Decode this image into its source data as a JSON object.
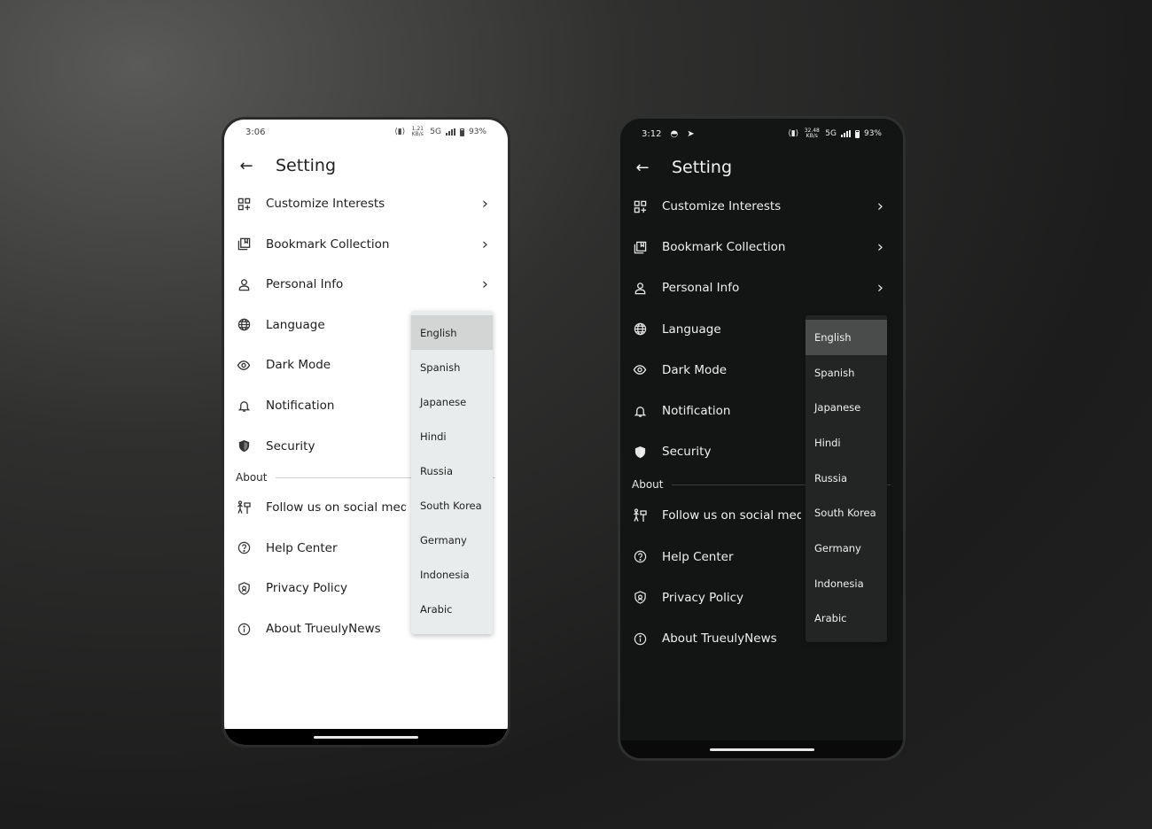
{
  "screens": [
    {
      "theme": "light",
      "status": {
        "time": "3:06",
        "speed": "1.21 KB/s",
        "net": "5G",
        "battery": "93%"
      },
      "title": "Setting",
      "items": [
        {
          "label": "Customize Interests",
          "icon": "grid-plus-icon",
          "chevron": true
        },
        {
          "label": "Bookmark Collection",
          "icon": "bookmark-stack-icon",
          "chevron": true
        },
        {
          "label": "Personal Info",
          "icon": "user-icon",
          "chevron": true
        },
        {
          "label": "Language",
          "icon": "globe-icon",
          "chevron": false
        },
        {
          "label": "Dark Mode",
          "icon": "eye-icon",
          "chevron": false
        },
        {
          "label": "Notification",
          "icon": "bell-icon",
          "chevron": false
        },
        {
          "label": "Security",
          "icon": "shield-icon",
          "chevron": false
        }
      ],
      "section": "About",
      "about_items": [
        {
          "label": "Follow us on social media",
          "icon": "social-icon",
          "chevron": false
        },
        {
          "label": "Help Center",
          "icon": "help-icon",
          "chevron": false
        },
        {
          "label": "Privacy Policy",
          "icon": "privacy-shield-icon",
          "chevron": false
        },
        {
          "label": "About TrueulyNews",
          "icon": "info-icon",
          "chevron": true
        }
      ],
      "languages": [
        "English",
        "Spanish",
        "Japanese",
        "Hindi",
        "Russia",
        "South Korea",
        "Germany",
        "Indonesia",
        "Arabic"
      ],
      "selected_language": "English"
    },
    {
      "theme": "dark",
      "status": {
        "time": "3:12",
        "speed": "32.48 KB/s",
        "net": "5G",
        "battery": "93%"
      },
      "title": "Setting",
      "items": [
        {
          "label": "Customize Interests",
          "icon": "grid-plus-icon",
          "chevron": true
        },
        {
          "label": "Bookmark Collection",
          "icon": "bookmark-stack-icon",
          "chevron": true
        },
        {
          "label": "Personal Info",
          "icon": "user-icon",
          "chevron": true
        },
        {
          "label": "Language",
          "icon": "globe-icon",
          "chevron": false
        },
        {
          "label": "Dark Mode",
          "icon": "eye-icon",
          "chevron": false
        },
        {
          "label": "Notification",
          "icon": "bell-icon",
          "chevron": false
        },
        {
          "label": "Security",
          "icon": "shield-icon",
          "chevron": false
        }
      ],
      "section": "About",
      "about_items": [
        {
          "label": "Follow us on social media",
          "icon": "social-icon",
          "chevron": false
        },
        {
          "label": "Help Center",
          "icon": "help-icon",
          "chevron": false
        },
        {
          "label": "Privacy Policy",
          "icon": "privacy-shield-icon",
          "chevron": false
        },
        {
          "label": "About TrueulyNews",
          "icon": "info-icon",
          "chevron": true
        }
      ],
      "languages": [
        "English",
        "Spanish",
        "Japanese",
        "Hindi",
        "Russia",
        "South Korea",
        "Germany",
        "Indonesia",
        "Arabic"
      ],
      "selected_language": "English"
    }
  ]
}
